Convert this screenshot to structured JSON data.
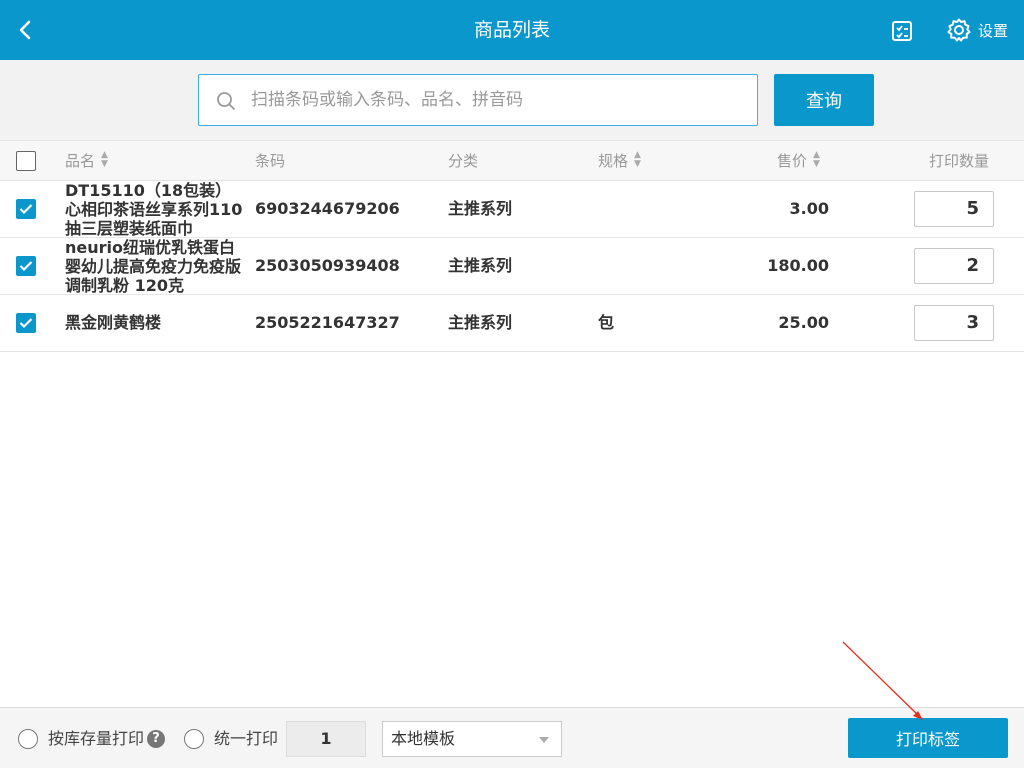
{
  "header": {
    "title": "商品列表",
    "settings_label": "设置",
    "background_color": "#0a98cc"
  },
  "search": {
    "placeholder": "扫描条码或输入条码、品名、拼音码",
    "value": "",
    "button_label": "查询"
  },
  "table": {
    "columns": {
      "name": "品名",
      "barcode": "条码",
      "category": "分类",
      "spec": "规格",
      "price": "售价",
      "quantity": "打印数量"
    },
    "select_all_checked": false,
    "rows": [
      {
        "checked": true,
        "name": "DT15110（18包装）心相印茶语丝享系列110抽三层塑装纸面巾",
        "barcode": "6903244679206",
        "category": "主推系列",
        "spec": "",
        "price": "3.00",
        "quantity": "5"
      },
      {
        "checked": true,
        "name": "neurio纽瑞优乳铁蛋白婴幼儿提高免疫力免疫版调制乳粉 120克",
        "barcode": "2503050939408",
        "category": "主推系列",
        "spec": "",
        "price": "180.00",
        "quantity": "2"
      },
      {
        "checked": true,
        "name": "黑金刚黄鹤楼",
        "barcode": "2505221647327",
        "category": "主推系列",
        "spec": "包",
        "price": "25.00",
        "quantity": "3"
      }
    ]
  },
  "footer": {
    "print_by_stock_label": "按库存量打印",
    "print_by_stock_selected": false,
    "help_icon_text": "?",
    "uniform_print_label": "统一打印",
    "uniform_print_selected": false,
    "copies_value": "1",
    "template_value": "本地模板",
    "print_button_label": "打印标签"
  },
  "annotation": {
    "arrow_color": "#e03020"
  }
}
